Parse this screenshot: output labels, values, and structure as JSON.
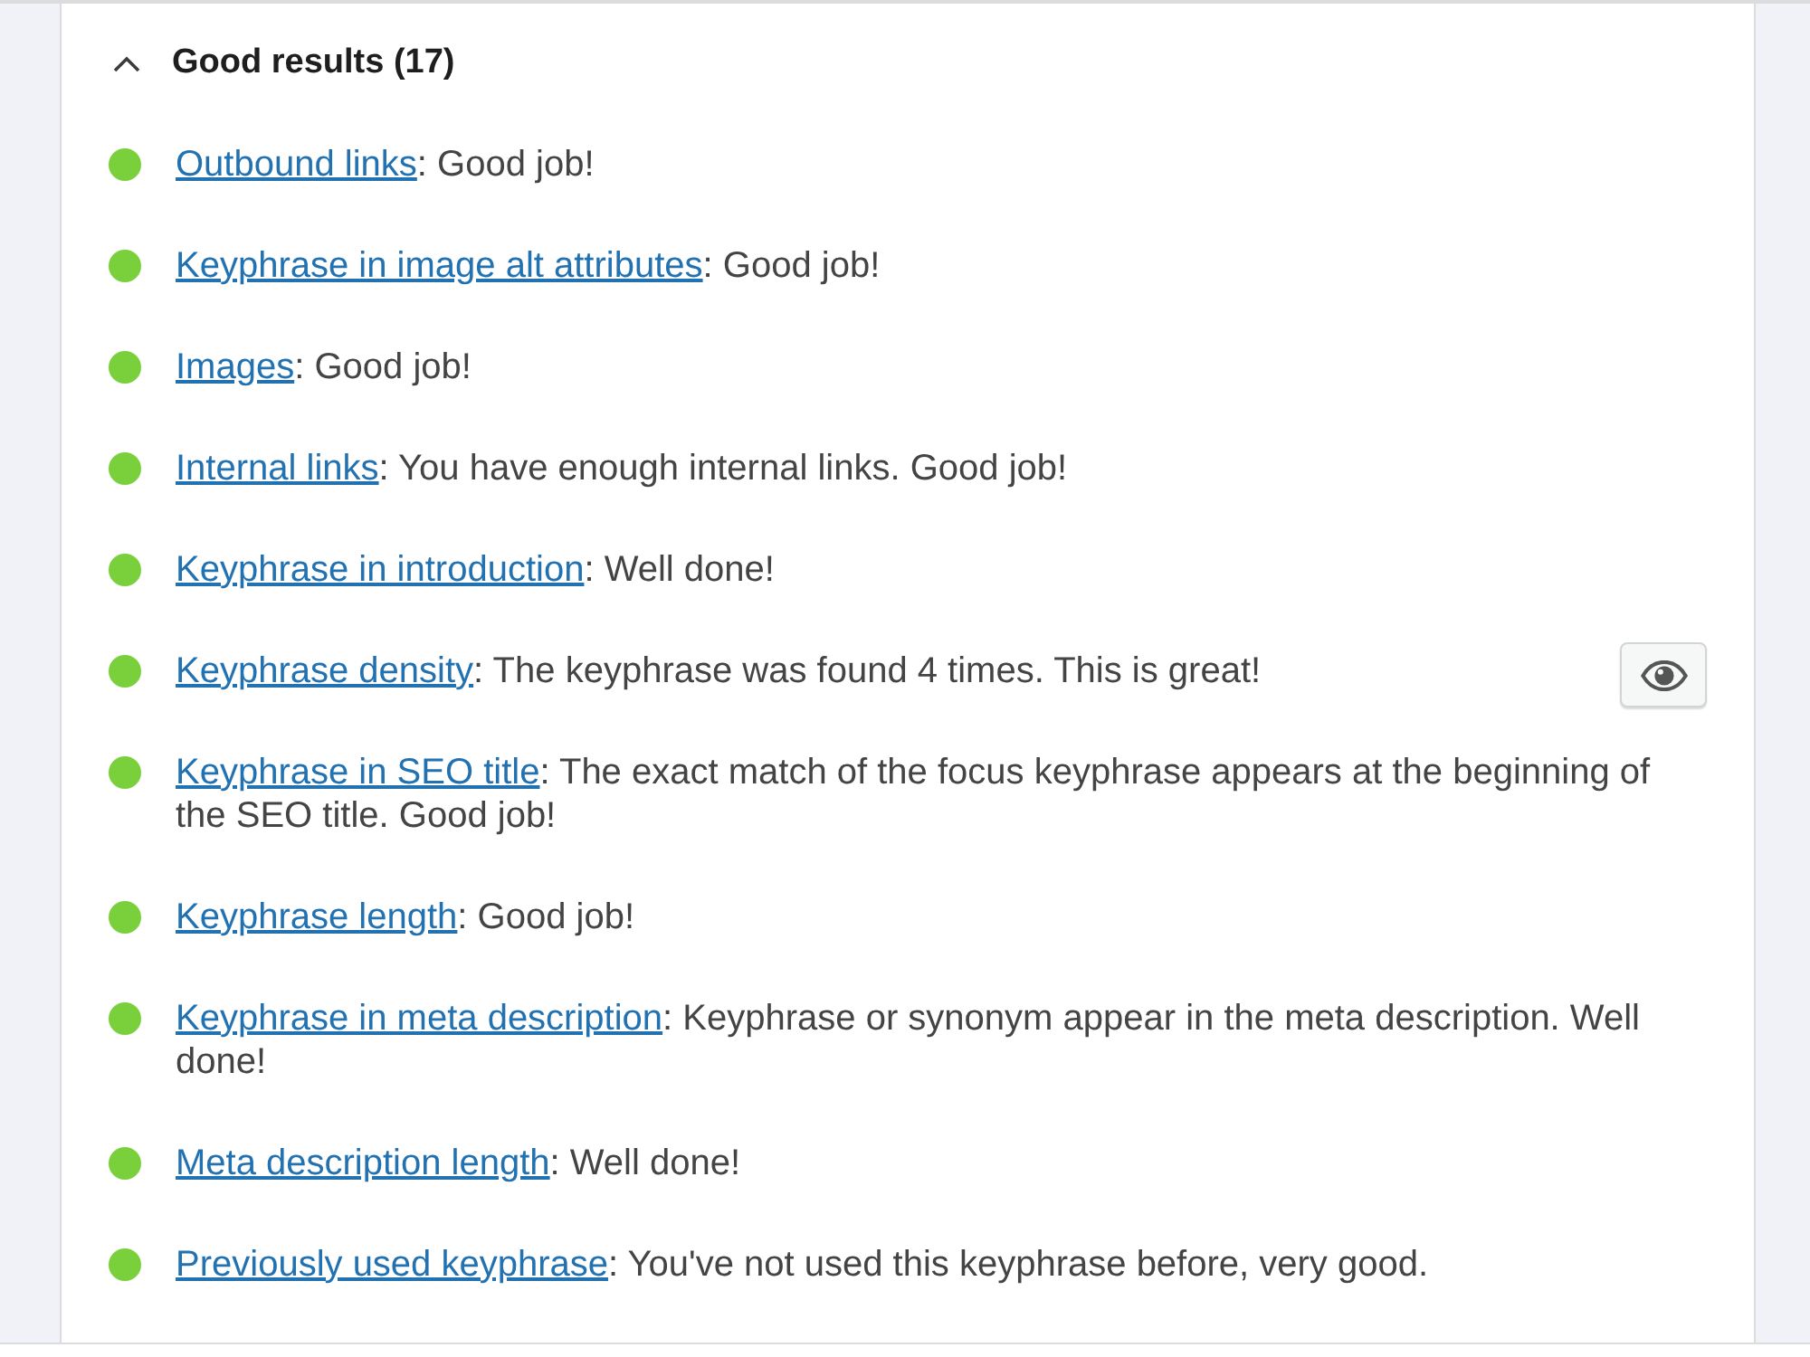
{
  "section": {
    "title": "Good results (17)",
    "expanded": true
  },
  "results": [
    {
      "link": "Outbound links",
      "text": ": Good job!",
      "color": "#7ad03a",
      "eye_button": false
    },
    {
      "link": "Keyphrase in image alt attributes",
      "text": ": Good job!",
      "color": "#7ad03a",
      "eye_button": false
    },
    {
      "link": "Images",
      "text": ": Good job!",
      "color": "#7ad03a",
      "eye_button": false
    },
    {
      "link": "Internal links",
      "text": ": You have enough internal links. Good job!",
      "color": "#7ad03a",
      "eye_button": false
    },
    {
      "link": "Keyphrase in introduction",
      "text": ": Well done!",
      "color": "#7ad03a",
      "eye_button": false
    },
    {
      "link": "Keyphrase density",
      "text": ": The keyphrase was found 4 times. This is great!",
      "color": "#7ad03a",
      "eye_button": true
    },
    {
      "link": "Keyphrase in SEO title",
      "text": ": The exact match of the focus keyphrase appears at the beginning of the SEO title. Good job!",
      "color": "#7ad03a",
      "eye_button": false
    },
    {
      "link": "Keyphrase length",
      "text": ": Good job!",
      "color": "#7ad03a",
      "eye_button": false
    },
    {
      "link": "Keyphrase in meta description",
      "text": ": Keyphrase or synonym appear in the meta description. Well done!",
      "color": "#7ad03a",
      "eye_button": false
    },
    {
      "link": "Meta description length",
      "text": ": Well done!",
      "color": "#7ad03a",
      "eye_button": false
    },
    {
      "link": "Previously used keyphrase",
      "text": ": You've not used this keyphrase before, very good.",
      "color": "#7ad03a",
      "eye_button": false
    }
  ]
}
